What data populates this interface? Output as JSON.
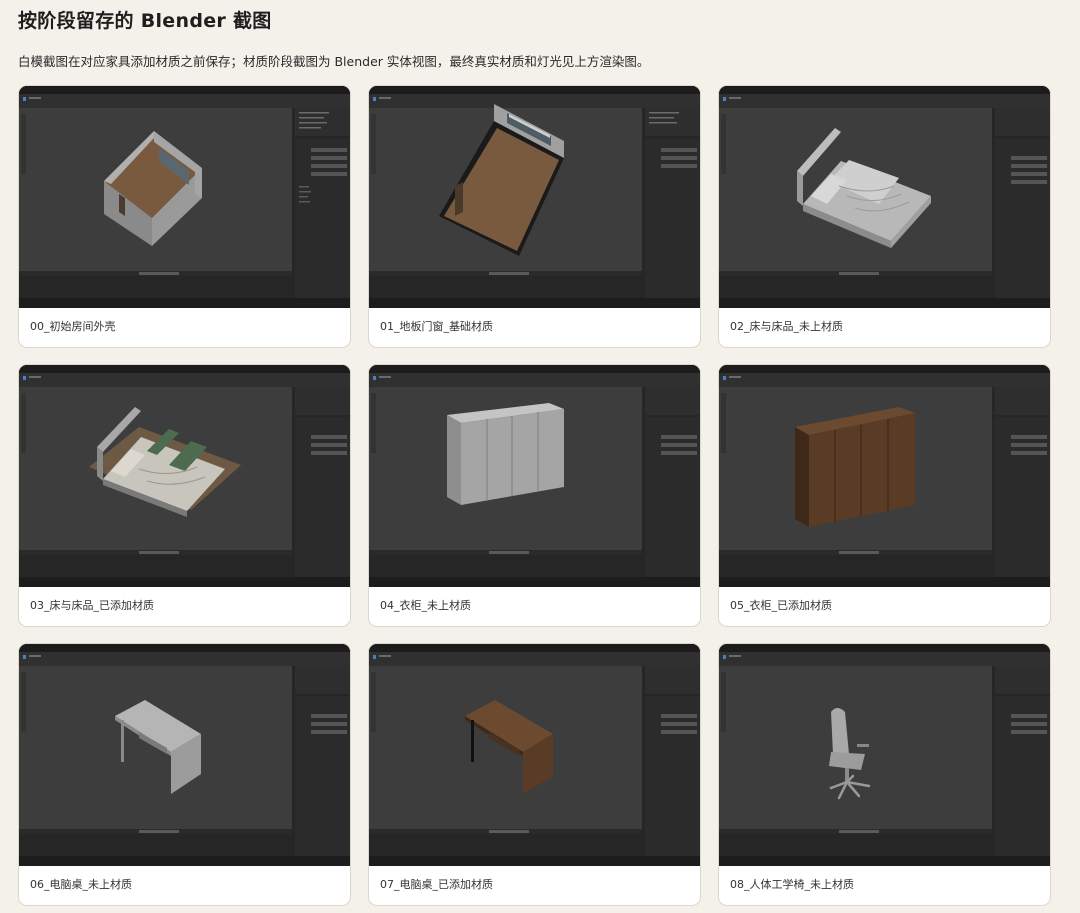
{
  "page": {
    "title": "按阶段留存的 Blender 截图",
    "description": "白模截图在对应家具添加材质之前保存；材质阶段截图为 Blender 实体视图，最终真实材质和灯光见上方渲染图。"
  },
  "cards": [
    {
      "caption": "00_初始房间外壳",
      "scene": "room-shell-icon"
    },
    {
      "caption": "01_地板门窗_基础材质",
      "scene": "room-floor-door-window-icon"
    },
    {
      "caption": "02_床与床品_未上材质",
      "scene": "bed-untextured-icon"
    },
    {
      "caption": "03_床与床品_已添加材质",
      "scene": "bed-textured-icon"
    },
    {
      "caption": "04_衣柜_未上材质",
      "scene": "wardrobe-untextured-icon"
    },
    {
      "caption": "05_衣柜_已添加材质",
      "scene": "wardrobe-textured-icon"
    },
    {
      "caption": "06_电脑桌_未上材质",
      "scene": "desk-untextured-icon"
    },
    {
      "caption": "07_电脑桌_已添加材质",
      "scene": "desk-textured-icon"
    },
    {
      "caption": "08_人体工学椅_未上材质",
      "scene": "office-chair-icon"
    }
  ],
  "colors": {
    "page_bg": "#f4f1ea",
    "viewport_bg": "#3d3d3d",
    "ui_dark": "#1f1f1f",
    "ui_panel": "#2e2e2e",
    "wood": "#5a3b25",
    "floor": "#7a5a3e",
    "model_grey": "#a8a8a8",
    "fabric_green": "#4d6b4e"
  }
}
